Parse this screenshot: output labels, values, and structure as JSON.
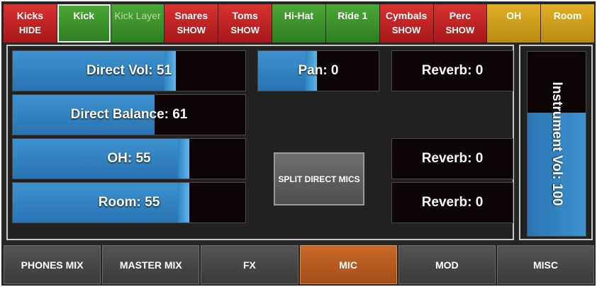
{
  "top_tabs": [
    {
      "l1": "Kicks",
      "l2": "HIDE",
      "color": "#c8282a",
      "selected": false,
      "dim": false
    },
    {
      "l1": "Kick",
      "l2": "",
      "color": "#3f9a2c",
      "selected": true,
      "dim": false
    },
    {
      "l1": "Kick Layer",
      "l2": "",
      "color": "#3f9a2c",
      "selected": false,
      "dim": true
    },
    {
      "l1": "Snares",
      "l2": "SHOW",
      "color": "#c8282a",
      "selected": false,
      "dim": false
    },
    {
      "l1": "Toms",
      "l2": "SHOW",
      "color": "#c8282a",
      "selected": false,
      "dim": false
    },
    {
      "l1": "Hi-Hat",
      "l2": "",
      "color": "#3f9a2c",
      "selected": false,
      "dim": false
    },
    {
      "l1": "Ride 1",
      "l2": "",
      "color": "#3f9a2c",
      "selected": false,
      "dim": false
    },
    {
      "l1": "Cymbals",
      "l2": "SHOW",
      "color": "#c8282a",
      "selected": false,
      "dim": false
    },
    {
      "l1": "Perc",
      "l2": "SHOW",
      "color": "#c8282a",
      "selected": false,
      "dim": false
    },
    {
      "l1": "OH",
      "l2": "",
      "color": "#d4a11d",
      "selected": false,
      "dim": false
    },
    {
      "l1": "Room",
      "l2": "",
      "color": "#d4a11d",
      "selected": false,
      "dim": false
    }
  ],
  "controls": {
    "direct_vol": {
      "label": "Direct Vol: 51",
      "level": 0.7
    },
    "direct_balance": {
      "label": "Direct Balance: 61",
      "level": 0.61
    },
    "oh": {
      "label": "OH: 55",
      "level": 0.76
    },
    "room": {
      "label": "Room: 55",
      "level": 0.76
    },
    "pan": {
      "label": "Pan: 0",
      "level": 0.49
    },
    "reverb_1": {
      "label": "Reverb: 0",
      "level": 0
    },
    "reverb_2": {
      "label": "Reverb: 0",
      "level": 0
    },
    "reverb_3": {
      "label": "Reverb: 0",
      "level": 0
    }
  },
  "split_button": {
    "label": "SPLIT DIRECT MICS"
  },
  "instrument_vol": {
    "label": "Instrument Vol: 100",
    "level": 0.67
  },
  "bottom_tabs": [
    {
      "label": "PHONES MIX",
      "active": false
    },
    {
      "label": "MASTER MIX",
      "active": false
    },
    {
      "label": "FX",
      "active": false
    },
    {
      "label": "MIC",
      "active": true
    },
    {
      "label": "MOD",
      "active": false
    },
    {
      "label": "MISC",
      "active": false
    }
  ],
  "colors": {
    "accent_blue": "#3d93cf",
    "active_tab": "#c96a2a",
    "red_tab": "#c8282a",
    "green_tab": "#3f9a2c",
    "yellow_tab": "#d4a11d"
  }
}
